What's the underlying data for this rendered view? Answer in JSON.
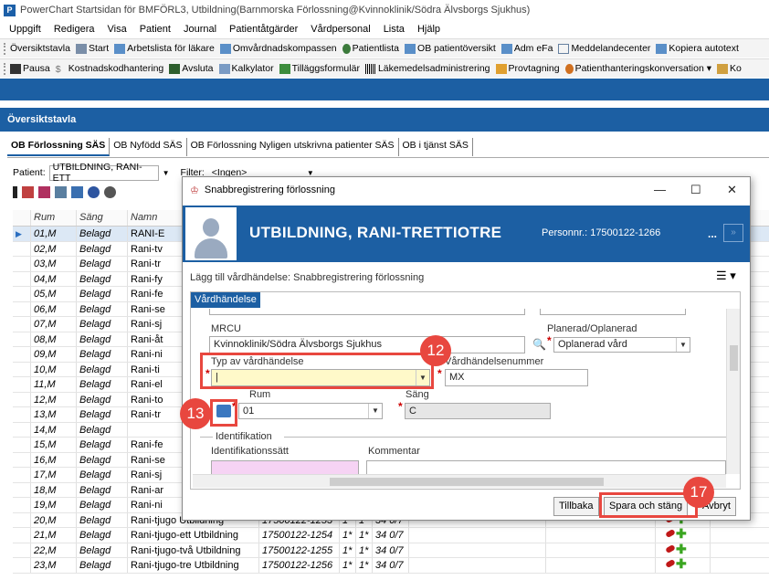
{
  "window": {
    "app_letter": "P",
    "title": "PowerChart Startsidan för BMFÖRL3, Utbildning(Barnmorska Förlossning@Kvinnoklinik/Södra Älvsborgs Sjukhus)"
  },
  "menu": [
    "Uppgift",
    "Redigera",
    "Visa",
    "Patient",
    "Journal",
    "Patientåtgärder",
    "Vårdpersonal",
    "Lista",
    "Hjälp"
  ],
  "toolbar1": [
    "Översiktstavla",
    "Start",
    "Arbetslista för läkare",
    "Omvårdnadskompassen",
    "Patientlista",
    "OB patientöversikt",
    "Adm eFa",
    "Meddelandecenter",
    "Kopiera autotext"
  ],
  "toolbar2": [
    "Pausa",
    "Kostnadskodhantering",
    "Avsluta",
    "Kalkylator",
    "Tilläggsformulär",
    "Läkemedelsadministrering",
    "Provtagning",
    "Patienthanteringskonversation ▾",
    "Ko"
  ],
  "section_title": "Översiktstavla",
  "tabs": [
    "OB Förlossning SÄS",
    "OB Nyfödd SÄS",
    "OB Förlossning Nyligen utskrivna patienter SÄS",
    "OB i tjänst SÄS"
  ],
  "patient_filter": {
    "patient_label": "Patient:",
    "patient_value": "UTBILDNING, RANI-ETT",
    "filter_label": "Filter:",
    "filter_value": "<Ingen>"
  },
  "grid": {
    "headers": [
      "",
      "Rum",
      "Säng",
      "Namn"
    ],
    "rows": [
      {
        "rum": "01,M",
        "sang": "Belagd",
        "namn": "RANI-E"
      },
      {
        "rum": "02,M",
        "sang": "Belagd",
        "namn": "Rani-tv"
      },
      {
        "rum": "03,M",
        "sang": "Belagd",
        "namn": "Rani-tr"
      },
      {
        "rum": "04,M",
        "sang": "Belagd",
        "namn": "Rani-fy"
      },
      {
        "rum": "05,M",
        "sang": "Belagd",
        "namn": "Rani-fe"
      },
      {
        "rum": "06,M",
        "sang": "Belagd",
        "namn": "Rani-se"
      },
      {
        "rum": "07,M",
        "sang": "Belagd",
        "namn": "Rani-sj"
      },
      {
        "rum": "08,M",
        "sang": "Belagd",
        "namn": "Rani-åt"
      },
      {
        "rum": "09,M",
        "sang": "Belagd",
        "namn": "Rani-ni"
      },
      {
        "rum": "10,M",
        "sang": "Belagd",
        "namn": "Rani-ti"
      },
      {
        "rum": "11,M",
        "sang": "Belagd",
        "namn": "Rani-el"
      },
      {
        "rum": "12,M",
        "sang": "Belagd",
        "namn": "Rani-to"
      },
      {
        "rum": "13,M",
        "sang": "Belagd",
        "namn": "Rani-tr"
      },
      {
        "rum": "14,M",
        "sang": "Belagd",
        "namn": ""
      },
      {
        "rum": "15,M",
        "sang": "Belagd",
        "namn": "Rani-fe"
      },
      {
        "rum": "16,M",
        "sang": "Belagd",
        "namn": "Rani-se"
      },
      {
        "rum": "17,M",
        "sang": "Belagd",
        "namn": "Rani-sj"
      },
      {
        "rum": "18,M",
        "sang": "Belagd",
        "namn": "Rani-ar"
      },
      {
        "rum": "19,M",
        "sang": "Belagd",
        "namn": "Rani-ni"
      },
      {
        "rum": "20,M",
        "sang": "Belagd",
        "namn": "Rani-tjugo Utbildning",
        "pnr": "17500122-1253",
        "a": "1*",
        "b": "1*",
        "c": "34 0/7"
      },
      {
        "rum": "21,M",
        "sang": "Belagd",
        "namn": "Rani-tjugo-ett Utbildning",
        "pnr": "17500122-1254",
        "a": "1*",
        "b": "1*",
        "c": "34 0/7"
      },
      {
        "rum": "22,M",
        "sang": "Belagd",
        "namn": "Rani-tjugo-två Utbildning",
        "pnr": "17500122-1255",
        "a": "1*",
        "b": "1*",
        "c": "34 0/7"
      },
      {
        "rum": "23,M",
        "sang": "Belagd",
        "namn": "Rani-tjugo-tre Utbildning",
        "pnr": "17500122-1256",
        "a": "1*",
        "b": "1*",
        "c": "34 0/7"
      }
    ]
  },
  "dialog": {
    "title": "Snabbregistrering förlossning",
    "minimize": "—",
    "maximize": "☐",
    "close": "✕",
    "patient_name": "UTBILDNING, RANI-TRETTIOTRE",
    "personnr": "Personnr.: 17500122-1266",
    "more": "...",
    "subtitle": "Lägg till vårdhändelse: Snabbregistrering förlossning",
    "panel_tab": "Vårdhändelse",
    "fields": {
      "mrcu_label": "MRCU",
      "mrcu_value": "Kvinnoklinik/Södra Älvsborgs Sjukhus",
      "planerad_label": "Planerad/Oplanerad",
      "planerad_value": "Oplanerad vård",
      "typ_label": "Typ av vårdhändelse",
      "typ_value": "|",
      "nummer_label": "Vårdhändelsenummer",
      "nummer_value": "MX",
      "rum_label": "Rum",
      "rum_value": "01",
      "sang_label": "Säng",
      "sang_value": "C",
      "ident_group": "Identifikation",
      "ident_label": "Identifikationssätt",
      "kommentar_label": "Kommentar"
    },
    "buttons": {
      "back": "Tillbaka",
      "save": "Spara och stäng",
      "cancel": "Avbryt"
    }
  },
  "callouts": {
    "badge_12": "12",
    "badge_13": "13",
    "badge_17": "17"
  },
  "colors": {
    "brand_blue": "#1c5fa3",
    "callout_red": "#e8473f"
  }
}
